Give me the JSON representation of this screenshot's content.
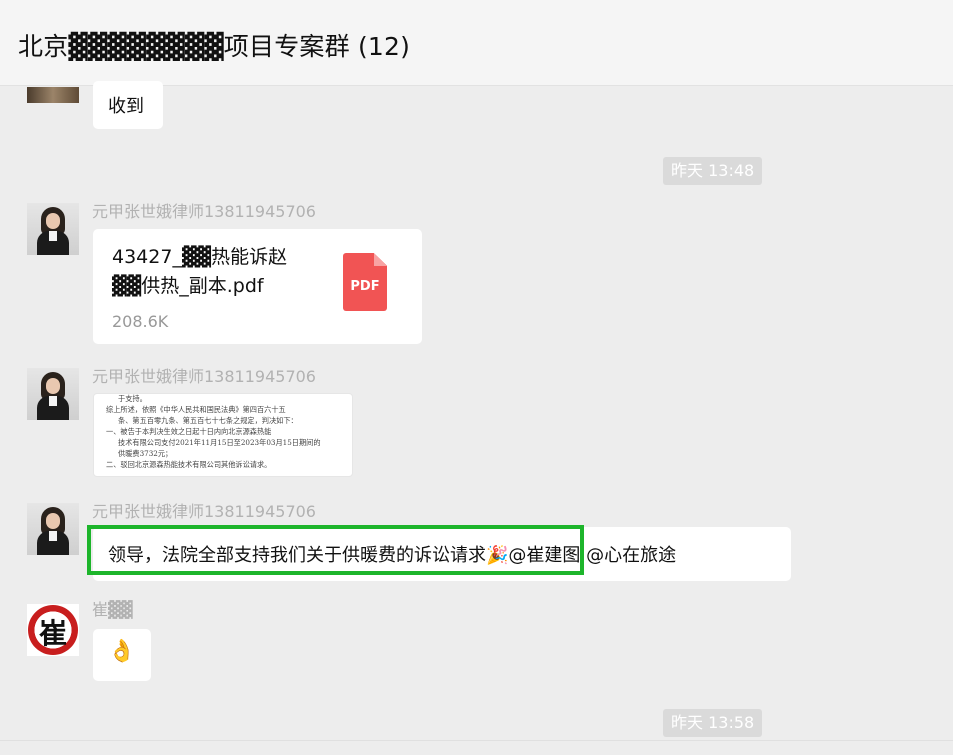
{
  "header": {
    "title": "北京▓▓▓▓▓▓▓▓项目专案群 (12)"
  },
  "messages": {
    "m1": {
      "text": "收到"
    },
    "t1": {
      "label": "昨天 13:48"
    },
    "m2": {
      "sender": "元甲张世娥律师13811945706",
      "file": {
        "name_line1": "43427_▓▓热能诉赵",
        "name_line2": "▓▓供热_副本.pdf",
        "size": "208.6K",
        "type_label": "PDF"
      }
    },
    "m3": {
      "sender": "元甲张世娥律师13811945706",
      "doc_lines": [
        "于支持。",
        "    综上所述，依照《中华人民共和国民法典》第四百六十五",
        "条、第五百零九条、第五百七十七条之规定，判决如下：",
        "    一、被告于本判决生效之日起十日内向北京源森热能",
        "技术有限公司支付2021年11月15日至2023年03月15日期间的",
        "供暖费3732元；",
        "    二、驳回北京源森热能技术有限公司其他诉讼请求。"
      ]
    },
    "m4": {
      "sender": "元甲张世娥律师13811945706",
      "text": "领导，法院全部支持我们关于供暖费的诉讼请求",
      "emoji": "🎉",
      "mentions": "@崔建图 @心在旅途",
      "highlight_color": "#1db52b"
    },
    "m5": {
      "sender": "崔▓▓",
      "avatar_glyph": "崔",
      "emoji": "👌"
    },
    "t2": {
      "label": "昨天 13:58"
    }
  },
  "colors": {
    "background": "#ededed",
    "bubble": "#ffffff",
    "highlight": "#1db52b",
    "pdf": "#f15454"
  }
}
